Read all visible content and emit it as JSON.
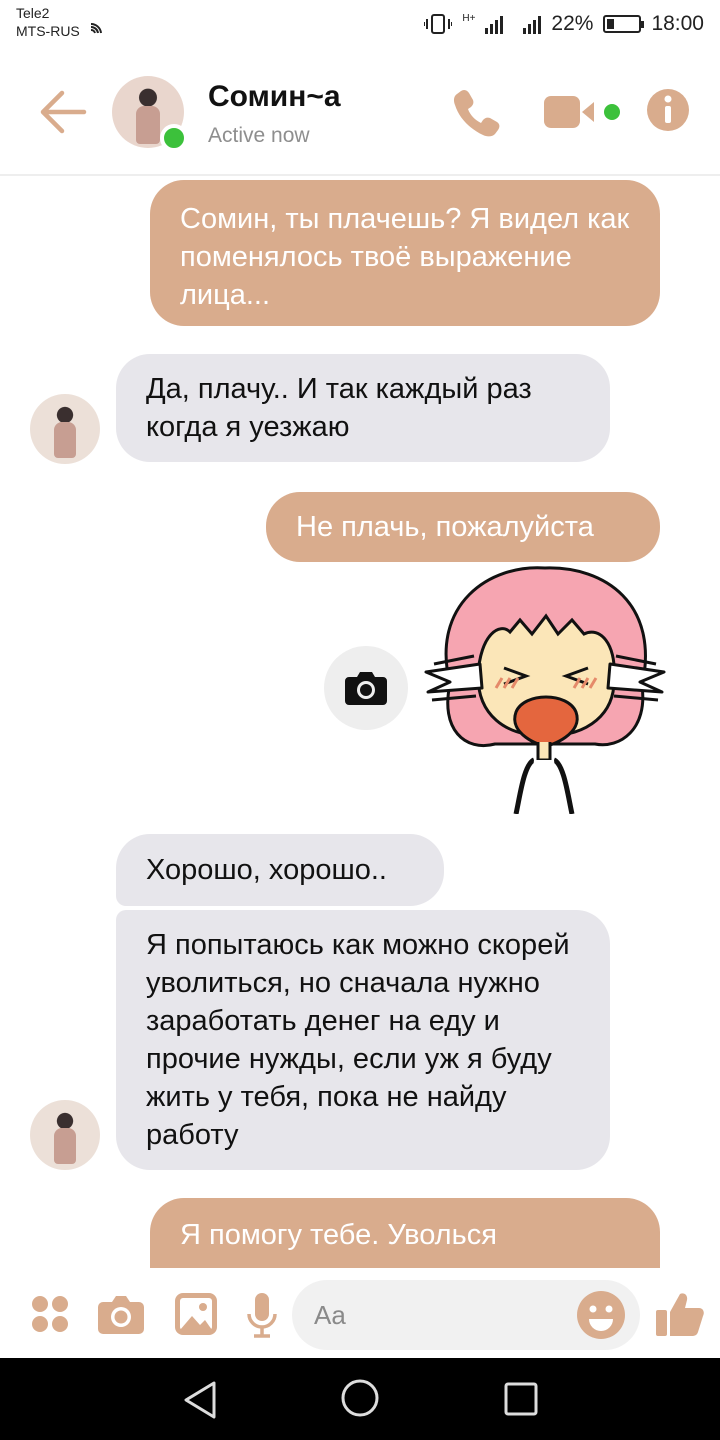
{
  "status_bar": {
    "carrier_1": "Tele2",
    "carrier_2": "MTS-RUS",
    "battery": "22%",
    "time": "18:00",
    "network": "H+"
  },
  "header": {
    "contact_name": "Сомин~а",
    "status": "Active now"
  },
  "messages": [
    {
      "direction": "out",
      "text": "Сомин, ты плачешь? Я видел как поменялось твоё выражение лица..."
    },
    {
      "direction": "in",
      "text": "Да, плачу.. И так каждый раз когда я уезжаю"
    },
    {
      "direction": "out",
      "text": "Не плачь, пожалуйста"
    },
    {
      "direction": "out",
      "type": "sticker",
      "icon": "crying-girl-sticker"
    },
    {
      "direction": "in",
      "text": "Хорошо, хорошо.."
    },
    {
      "direction": "in",
      "text": "Я попытаюсь как можно скорей уволиться, но сначала нужно заработать денег на еду и прочие нужды, если уж я буду жить у тебя, пока не найду работу"
    },
    {
      "direction": "out",
      "text": "Я помогу тебе. Уволься"
    }
  ],
  "composer": {
    "placeholder": "Aa"
  },
  "colors": {
    "accent": "#d9ac8d",
    "incoming_bubble": "#e7e6eb",
    "online": "#3cc13b"
  }
}
